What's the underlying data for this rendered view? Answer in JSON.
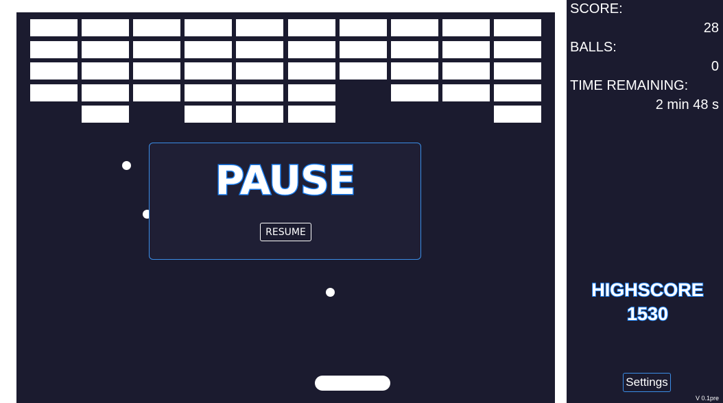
{
  "hud": {
    "score_label": "SCORE:",
    "score_value": "28",
    "balls_label": "BALLS:",
    "balls_value": "0",
    "time_label": "TIME REMAINING:",
    "time_value": "2 min 48 s",
    "highscore_label": "HIGHSCORE",
    "highscore_value": "1530",
    "settings_label": "Settings",
    "version": "V 0.1pre"
  },
  "pause": {
    "title": "PAUSE",
    "resume_label": "RESUME"
  },
  "bricks": [
    [
      1,
      1,
      1,
      1,
      1,
      1,
      1,
      1,
      1,
      1
    ],
    [
      1,
      1,
      1,
      1,
      1,
      1,
      1,
      1,
      1,
      1
    ],
    [
      1,
      1,
      1,
      1,
      1,
      1,
      1,
      1,
      1,
      1
    ],
    [
      1,
      1,
      1,
      1,
      1,
      1,
      0,
      1,
      1,
      1
    ],
    [
      0,
      1,
      0,
      1,
      1,
      1,
      0,
      0,
      0,
      1
    ]
  ],
  "balls_in_play": 3,
  "colors": {
    "background": "#1b1b2f",
    "frame": "#ffffff",
    "accent": "#1a7ef0"
  }
}
